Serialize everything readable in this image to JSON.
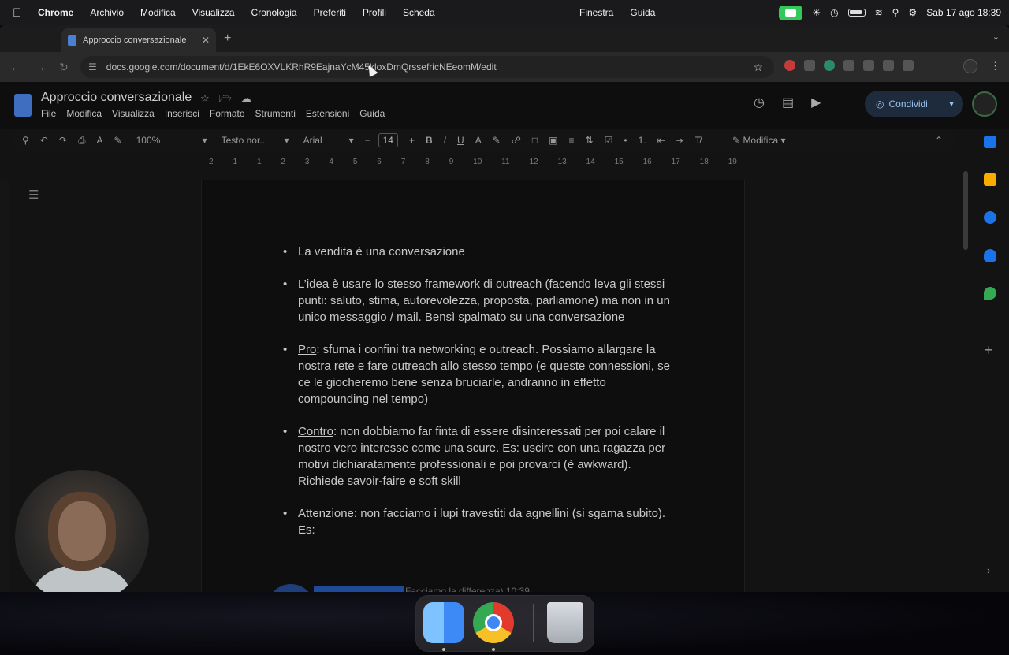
{
  "menubar": {
    "app": "Chrome",
    "menus": [
      "Archivio",
      "Modifica",
      "Visualizza",
      "Cronologia",
      "Preferiti",
      "Profili",
      "Scheda"
    ],
    "center_menus": [
      "Finestra",
      "Guida"
    ],
    "datetime": "Sab 17 ago  18:39"
  },
  "browser": {
    "tab_title": "Approccio conversazionale",
    "url": "docs.google.com/document/d/1EkE6OXVLKRhR9EajnaYcM45kloxDmQrssefricNEeomM/edit"
  },
  "docs": {
    "title": "Approccio conversazionale",
    "menu": [
      "File",
      "Modifica",
      "Visualizza",
      "Inserisci",
      "Formato",
      "Strumenti",
      "Estensioni",
      "Guida"
    ],
    "share_label": "Condividi",
    "toolbar": {
      "zoom": "100%",
      "style": "Testo nor...",
      "font": "Arial",
      "font_size": "14",
      "mode": "Modifica"
    },
    "ruler_ticks": [
      "2",
      "1",
      "1",
      "2",
      "3",
      "4",
      "5",
      "6",
      "7",
      "8",
      "9",
      "10",
      "11",
      "12",
      "13",
      "14",
      "15",
      "16",
      "17",
      "18",
      "19"
    ]
  },
  "document": {
    "bullets": [
      {
        "prefix": "",
        "text": "La vendita è una conversazione"
      },
      {
        "prefix": "",
        "text": "L’idea è usare lo stesso framework di outreach (facendo leva gli stessi punti: saluto, stima, autorevolezza, proposta, parliamone) ma non in un unico messaggio / mail. Bensì spalmato su una conversazione"
      },
      {
        "prefix": "Pro",
        "text": ": sfuma i confini tra networking e outreach. Possiamo allargare la nostra rete e fare outreach allo stesso tempo (e queste connessioni, se ce le giocheremo bene senza bruciarle, andranno in effetto compounding nel tempo)"
      },
      {
        "prefix": "Contro",
        "text": ": non dobbiamo far finta di essere disinteressati per poi calare il nostro vero interesse come una scure. Es: uscire con una ragazza per motivi dichiaratamente professionali e poi provarci (è awkward). Richiede savoir-faire e soft skill"
      },
      {
        "prefix": "",
        "text": "Attenzione: non facciamo i lupi travestiti da agnellini (si sgama subito). Es:"
      }
    ],
    "peek_text": "Facciamo la differenza)   10:39"
  },
  "icons": {
    "apple": "apple-icon",
    "search": "search-icon",
    "star": "star-icon"
  },
  "colors": {
    "menubar_bg": "#1a1a1c",
    "facetime_green": "#34c759",
    "share_bg": "#1d2b3c"
  }
}
